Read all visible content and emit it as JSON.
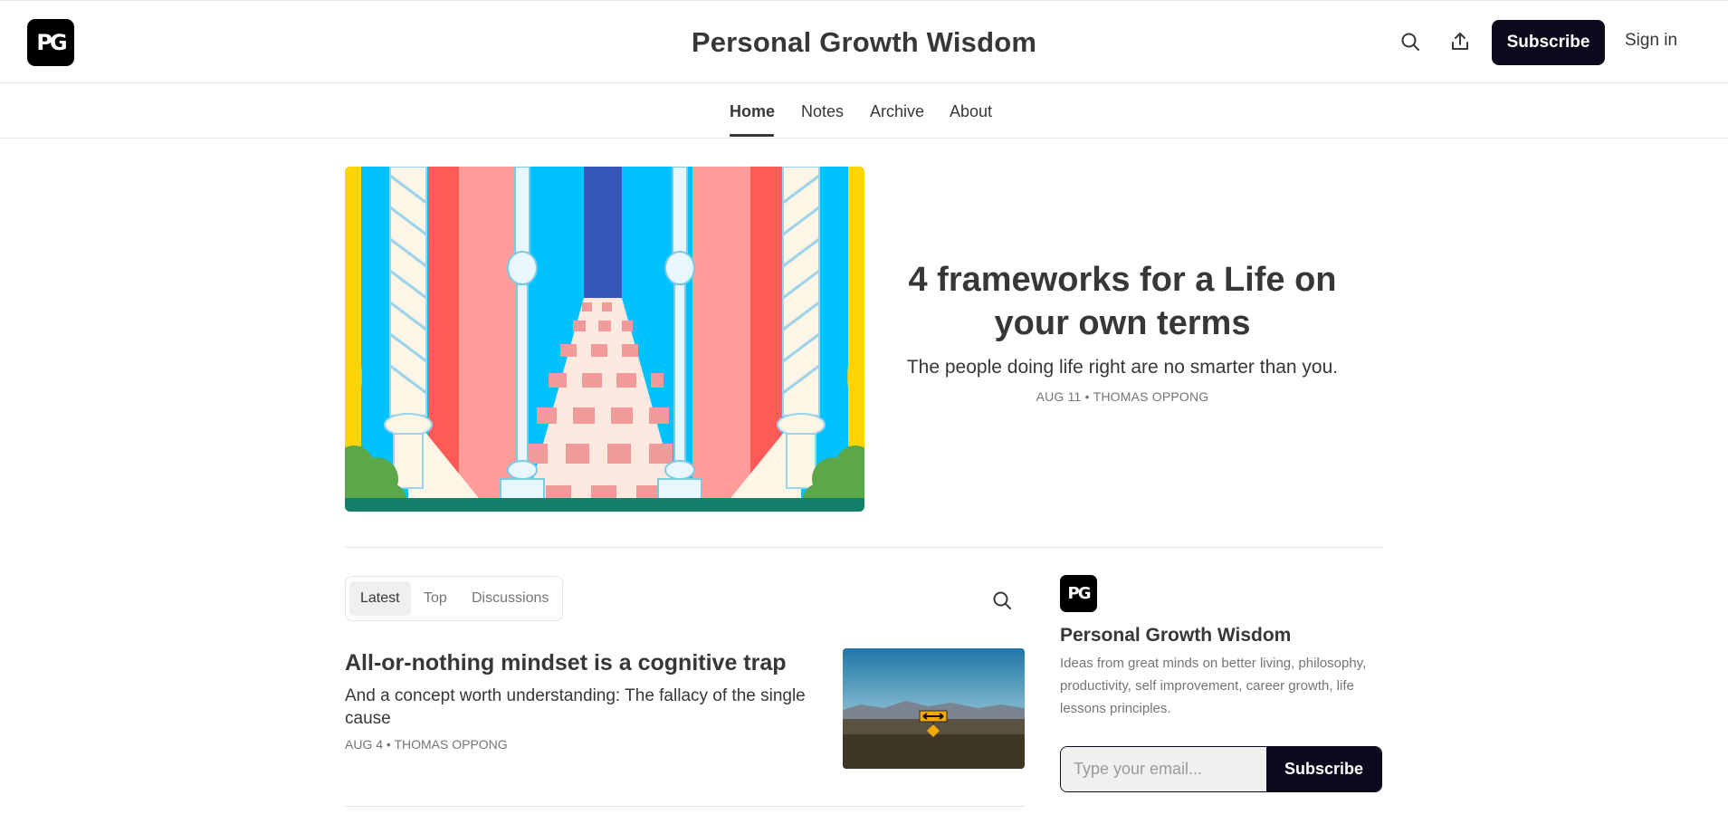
{
  "header": {
    "logo_text": "PG",
    "title": "Personal Growth Wisdom",
    "search_icon": "search-icon",
    "share_icon": "share-icon",
    "subscribe_label": "Subscribe",
    "signin_label": "Sign in"
  },
  "nav": {
    "items": [
      {
        "label": "Home",
        "active": true
      },
      {
        "label": "Notes",
        "active": false
      },
      {
        "label": "Archive",
        "active": false
      },
      {
        "label": "About",
        "active": false
      }
    ]
  },
  "hero": {
    "title": "4 frameworks for a Life on your own terms",
    "subtitle": "The people doing life right are no smarter than you.",
    "meta": "AUG 11 • THOMAS OPPONG"
  },
  "feed": {
    "tabs": [
      {
        "label": "Latest",
        "active": true
      },
      {
        "label": "Top",
        "active": false
      },
      {
        "label": "Discussions",
        "active": false
      }
    ],
    "search_icon": "search-icon",
    "posts": [
      {
        "title": "All-or-nothing mindset is a cognitive trap",
        "subtitle": "And a concept worth understanding: The fallacy of the single cause",
        "meta": "AUG 4 • THOMAS OPPONG"
      }
    ]
  },
  "sidebar": {
    "logo_text": "PG",
    "title": "Personal Growth Wisdom",
    "description": "Ideas from great minds on better living, philosophy, productivity, self improvement, career growth, life lessons principles.",
    "email_placeholder": "Type your email...",
    "subscribe_label": "Subscribe"
  },
  "colors": {
    "accent": "#0b0a1d",
    "text": "#363737",
    "muted": "#757575"
  }
}
